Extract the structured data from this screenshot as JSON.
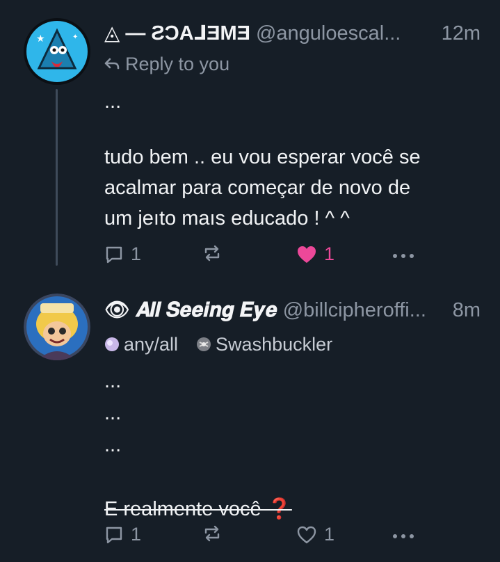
{
  "post1": {
    "display_name": "◬ — ƧƆA⅃ƎMƎ",
    "handle": "@anguloescal...",
    "time": "12m",
    "reply_to": "Reply to you",
    "lines": [
      "...",
      "",
      "tudo bem ..  eu vou esperar você se",
      "acalmar para começar de novo de",
      "um jeıto maıs educado !  ^ ^"
    ],
    "reply_count": "1",
    "like_count": "1",
    "liked": true
  },
  "post2": {
    "display_name": "👁 𝑨𝒍𝒍 𝑺𝒆𝒆𝒊𝒏𝒈 𝑬𝒚𝒆",
    "handle": "@billcipheroffi...",
    "time": "8m",
    "labels": [
      {
        "text": "any/all",
        "icon": "any-all-icon"
      },
      {
        "text": "Swashbuckler",
        "icon": "swashbuckler-icon"
      }
    ],
    "lines": [
      "...",
      "...",
      "...",
      "",
      "E realmente você ❓"
    ],
    "reply_count": "1",
    "like_count": "1"
  },
  "colors": {
    "background": "#161e27",
    "muted": "#8d96a3",
    "text": "#f1f3f5",
    "like": "#ec4899",
    "avatar1_bg": "#2fb6ea"
  }
}
